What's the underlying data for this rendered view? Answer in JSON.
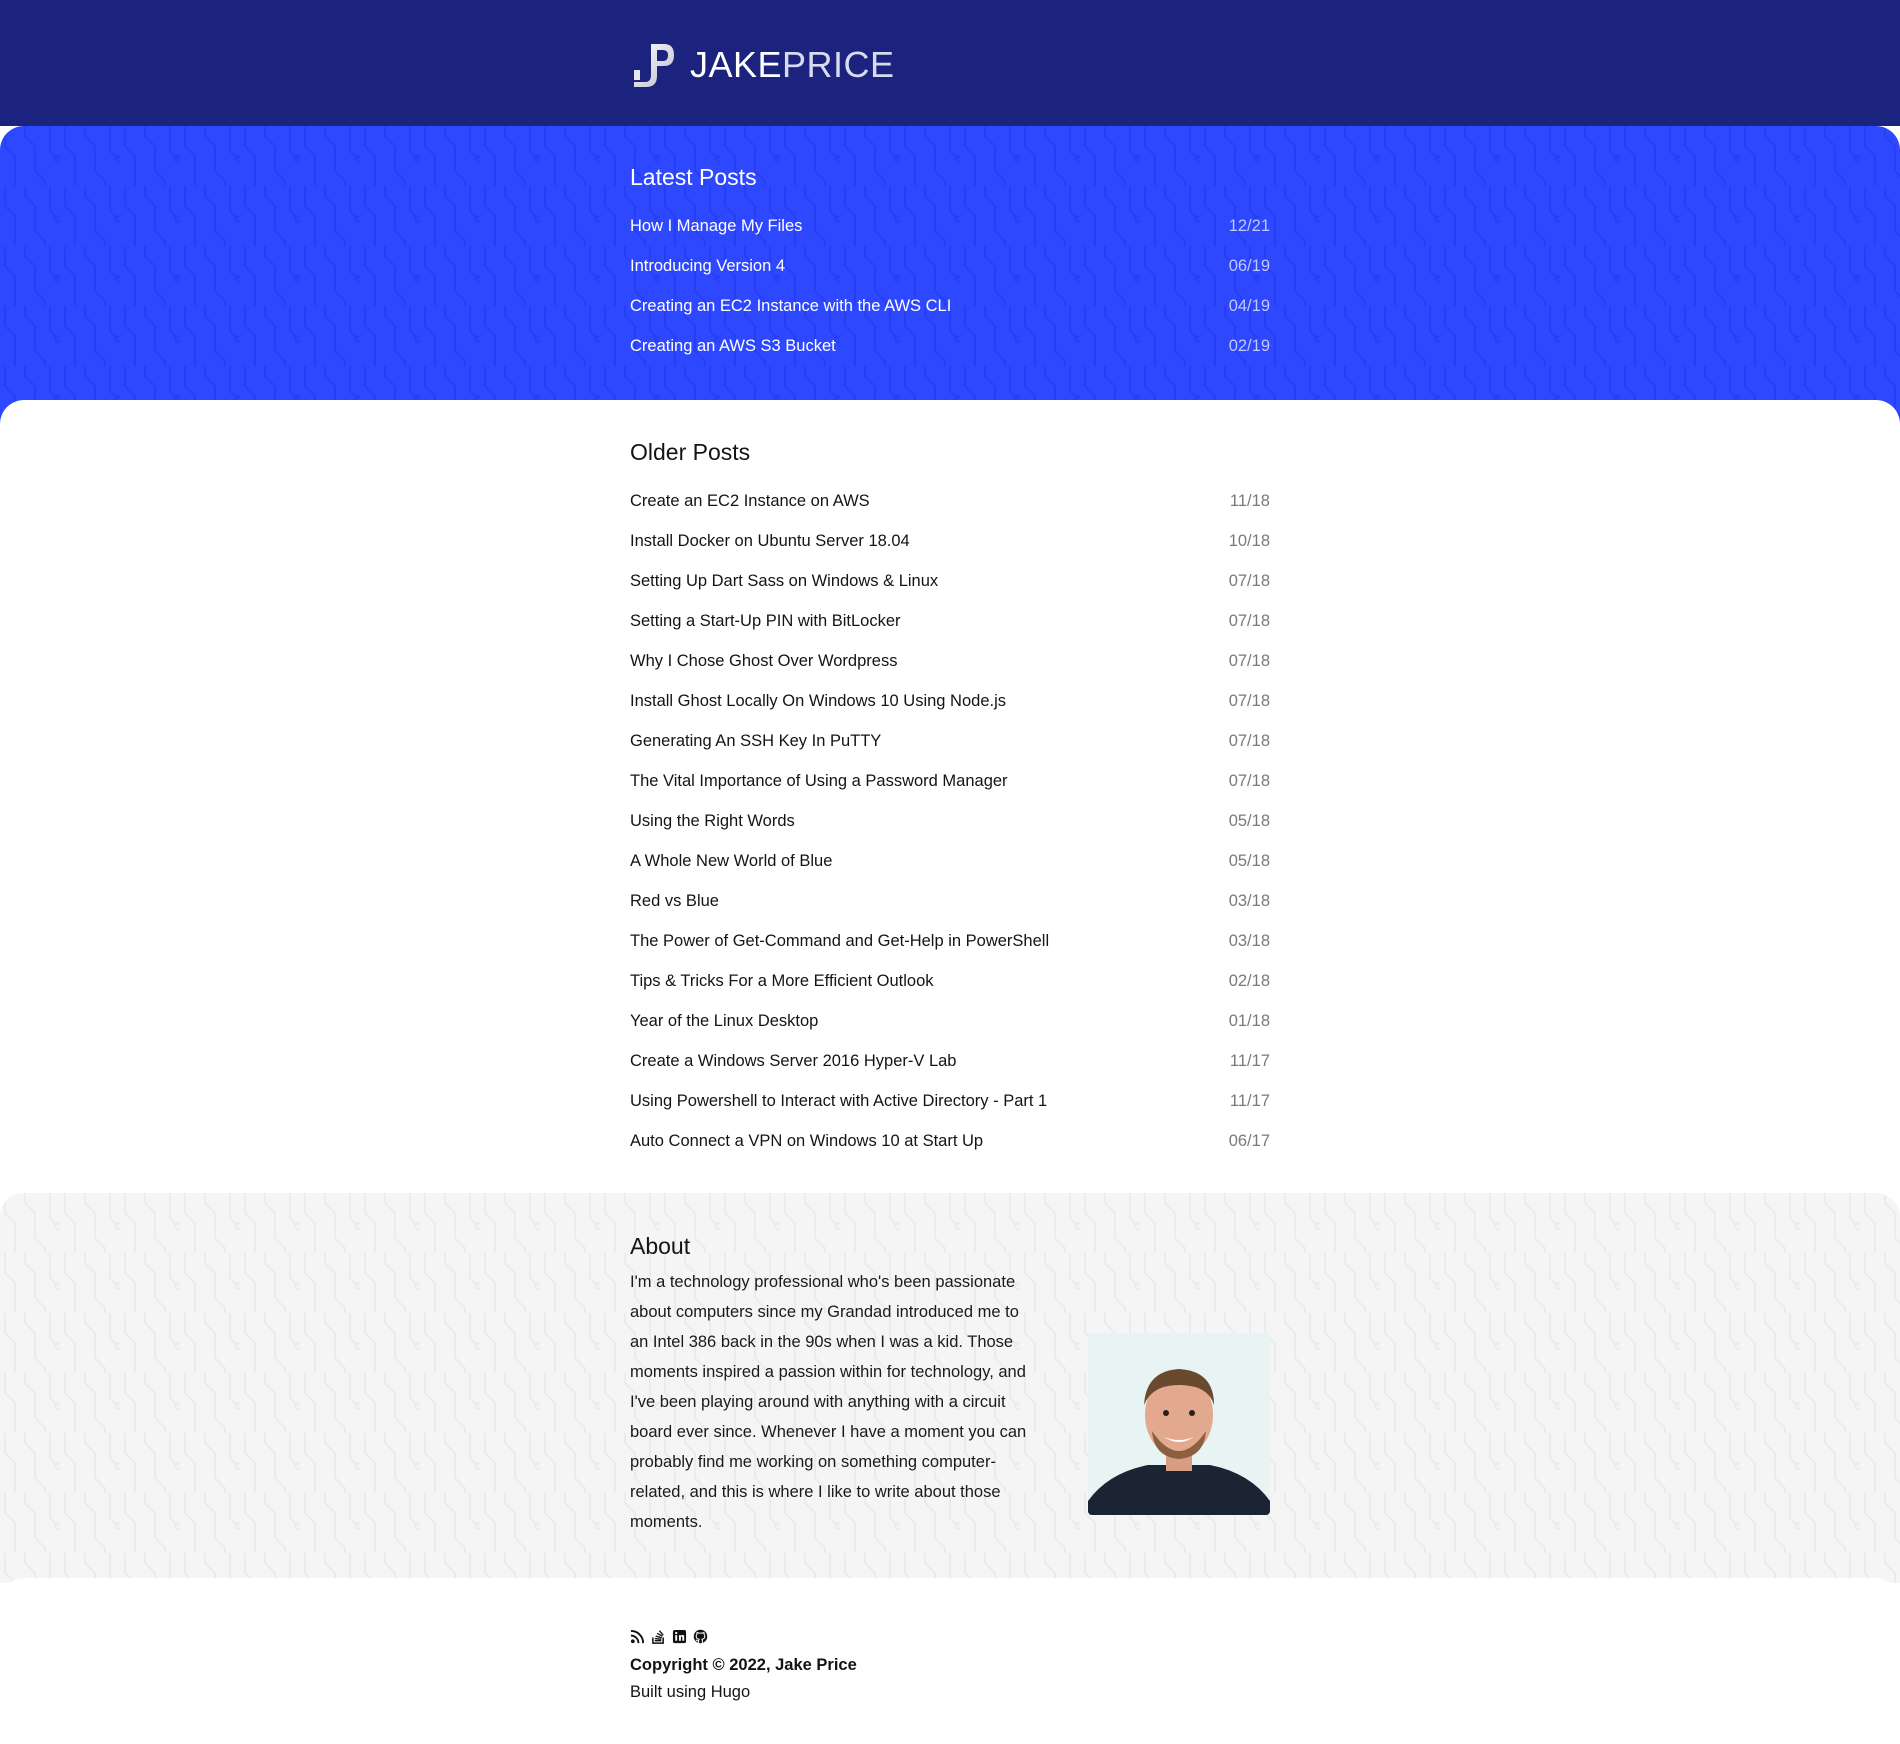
{
  "header": {
    "logo_icon": "jp-monogram-icon",
    "name_first": "JAKE",
    "name_last": "PRICE"
  },
  "colors": {
    "header_bg": "#1b237f",
    "latest_bg": "#2e48ff",
    "about_bg": "#f5f5f5"
  },
  "latest": {
    "title": "Latest Posts",
    "posts": [
      {
        "title": "How I Manage My Files",
        "date": "12/21"
      },
      {
        "title": "Introducing Version 4",
        "date": "06/19"
      },
      {
        "title": "Creating an EC2 Instance with the AWS CLI",
        "date": "04/19"
      },
      {
        "title": "Creating an AWS S3 Bucket",
        "date": "02/19"
      }
    ]
  },
  "older": {
    "title": "Older Posts",
    "posts": [
      {
        "title": "Create an EC2 Instance on AWS",
        "date": "11/18"
      },
      {
        "title": "Install Docker on Ubuntu Server 18.04",
        "date": "10/18"
      },
      {
        "title": "Setting Up Dart Sass on Windows & Linux",
        "date": "07/18"
      },
      {
        "title": "Setting a Start-Up PIN with BitLocker",
        "date": "07/18"
      },
      {
        "title": "Why I Chose Ghost Over Wordpress",
        "date": "07/18"
      },
      {
        "title": "Install Ghost Locally On Windows 10 Using Node.js",
        "date": "07/18"
      },
      {
        "title": "Generating An SSH Key In PuTTY",
        "date": "07/18"
      },
      {
        "title": "The Vital Importance of Using a Password Manager",
        "date": "07/18"
      },
      {
        "title": "Using the Right Words",
        "date": "05/18"
      },
      {
        "title": "A Whole New World of Blue",
        "date": "05/18"
      },
      {
        "title": "Red vs Blue",
        "date": "03/18"
      },
      {
        "title": "The Power of Get-Command and Get-Help in PowerShell",
        "date": "03/18"
      },
      {
        "title": "Tips & Tricks For a More Efficient Outlook",
        "date": "02/18"
      },
      {
        "title": "Year of the Linux Desktop",
        "date": "01/18"
      },
      {
        "title": "Create a Windows Server 2016 Hyper-V Lab",
        "date": "11/17"
      },
      {
        "title": "Using Powershell to Interact with Active Directory - Part 1",
        "date": "11/17"
      },
      {
        "title": "Auto Connect a VPN on Windows 10 at Start Up",
        "date": "06/17"
      }
    ]
  },
  "about": {
    "title": "About",
    "text": "I'm a technology professional who's been passionate about computers since my Grandad introduced me to an Intel 386 back in the 90s when I was a kid. Those moments inspired a passion within for technology, and I've been playing around with anything with a circuit board ever since. Whenever I have a moment you can probably find me working on something computer-related, and this is where I like to write about those moments.",
    "photo_icon": "portrait-photo"
  },
  "footer": {
    "social_icons": [
      "rss-icon",
      "stackoverflow-icon",
      "linkedin-icon",
      "github-icon"
    ],
    "copyright": "Copyright © 2022, Jake Price",
    "built": "Built using Hugo"
  }
}
